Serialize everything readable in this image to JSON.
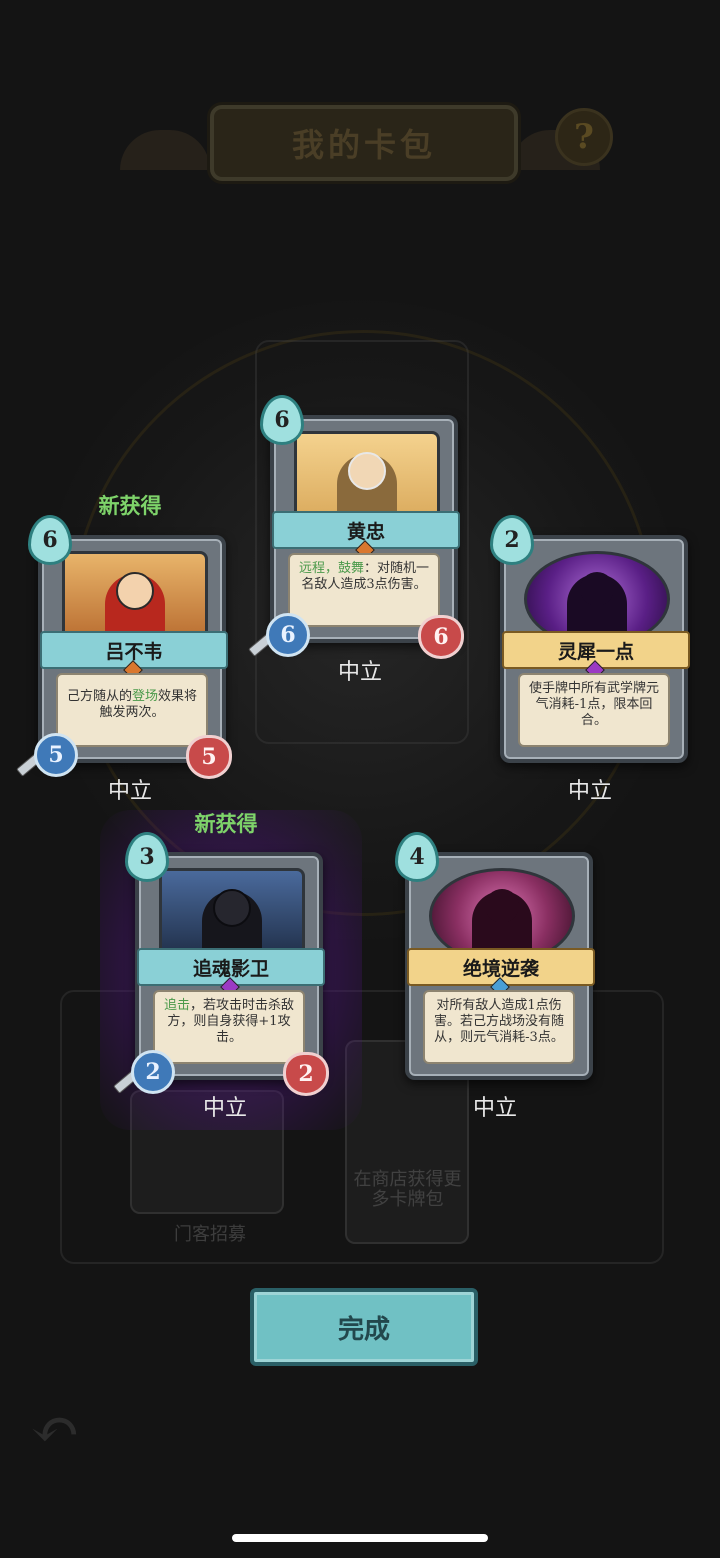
{
  "header": {
    "title": "我的卡包",
    "help_icon": "?"
  },
  "cards": [
    {
      "id": "huangzhong",
      "cost": "6",
      "name": "黄忠",
      "ribbon": "teal",
      "gem_color": "#d9772e",
      "desc_kw": "远程，鼓舞",
      "desc_rest": "：对随机一名敌人造成3点伤害。",
      "attack": "6",
      "health": "6",
      "faction": "中立",
      "new_label": ""
    },
    {
      "id": "lvbuwei",
      "cost": "6",
      "name": "吕不韦",
      "ribbon": "teal",
      "gem_color": "#d9772e",
      "desc_pre": "己方随从的",
      "desc_kw": "登场",
      "desc_rest": "效果将触发两次。",
      "attack": "5",
      "health": "5",
      "faction": "中立",
      "new_label": "新获得"
    },
    {
      "id": "lingxi",
      "cost": "2",
      "name": "灵犀一点",
      "ribbon": "gold",
      "gem_color": "#9b3ac4",
      "desc_rest": "使手牌中所有武学牌元气消耗-1点，限本回合。",
      "faction": "中立",
      "new_label": ""
    },
    {
      "id": "zhuihun",
      "cost": "3",
      "name": "追魂影卫",
      "ribbon": "teal",
      "gem_color": "#9b3ac4",
      "desc_kw": "追击",
      "desc_rest": "，若攻击时击杀敌方，则自身获得+1攻击。",
      "attack": "2",
      "health": "2",
      "faction": "中立",
      "new_label": "新获得"
    },
    {
      "id": "juejing",
      "cost": "4",
      "name": "绝境逆袭",
      "ribbon": "gold",
      "gem_color": "#4a9fd6",
      "desc_rest": "对所有敌人造成1点伤害。若己方战场没有随从，则元气消耗-3点。",
      "faction": "中立",
      "new_label": ""
    }
  ],
  "background": {
    "shop_text": "在商店获得更多卡牌包",
    "chest_text": "门客招募"
  },
  "actions": {
    "done_label": "完成"
  },
  "colors": {
    "accent_teal": "#70c1c4",
    "new_green": "#7ed36a",
    "glow_purple": "#6e28aa"
  }
}
